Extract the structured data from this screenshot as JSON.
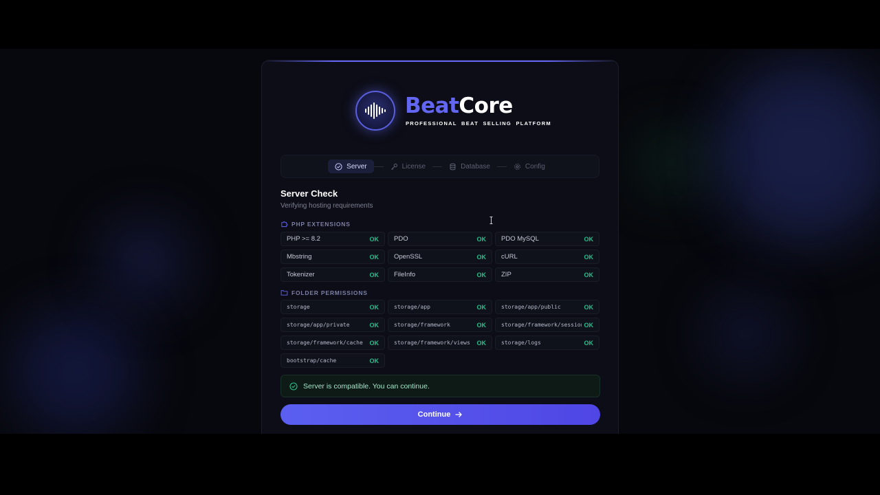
{
  "brand": {
    "name_part1": "Beat",
    "name_part2": "Core",
    "tagline": "PROFESSIONAL BEAT SELLING PLATFORM",
    "accent_color": "#6366f1"
  },
  "stepper": {
    "steps": [
      {
        "label": "Server",
        "icon": "check-circle-icon",
        "active": true
      },
      {
        "label": "License",
        "icon": "key-icon",
        "active": false
      },
      {
        "label": "Database",
        "icon": "database-icon",
        "active": false
      },
      {
        "label": "Config",
        "icon": "gear-icon",
        "active": false
      }
    ]
  },
  "section": {
    "title": "Server Check",
    "subtitle": "Verifying hosting requirements"
  },
  "php_extensions": {
    "heading": "PHP EXTENSIONS",
    "items": [
      {
        "label": "PHP >= 8.2",
        "status": "OK"
      },
      {
        "label": "PDO",
        "status": "OK"
      },
      {
        "label": "PDO MySQL",
        "status": "OK"
      },
      {
        "label": "Mbstring",
        "status": "OK"
      },
      {
        "label": "OpenSSL",
        "status": "OK"
      },
      {
        "label": "cURL",
        "status": "OK"
      },
      {
        "label": "Tokenizer",
        "status": "OK"
      },
      {
        "label": "FileInfo",
        "status": "OK"
      },
      {
        "label": "ZIP",
        "status": "OK"
      }
    ]
  },
  "folder_permissions": {
    "heading": "FOLDER PERMISSIONS",
    "items": [
      {
        "label": "storage",
        "status": "OK"
      },
      {
        "label": "storage/app",
        "status": "OK"
      },
      {
        "label": "storage/app/public",
        "status": "OK"
      },
      {
        "label": "storage/app/private",
        "status": "OK"
      },
      {
        "label": "storage/framework",
        "status": "OK"
      },
      {
        "label": "storage/framework/sessions",
        "status": "OK"
      },
      {
        "label": "storage/framework/cache",
        "status": "OK"
      },
      {
        "label": "storage/framework/views",
        "status": "OK"
      },
      {
        "label": "storage/logs",
        "status": "OK"
      },
      {
        "label": "bootstrap/cache",
        "status": "OK"
      }
    ]
  },
  "notice": {
    "text": "Server is compatible. You can continue.",
    "icon": "check-circle-icon",
    "color": "#27c08b"
  },
  "actions": {
    "continue_label": "Continue"
  }
}
